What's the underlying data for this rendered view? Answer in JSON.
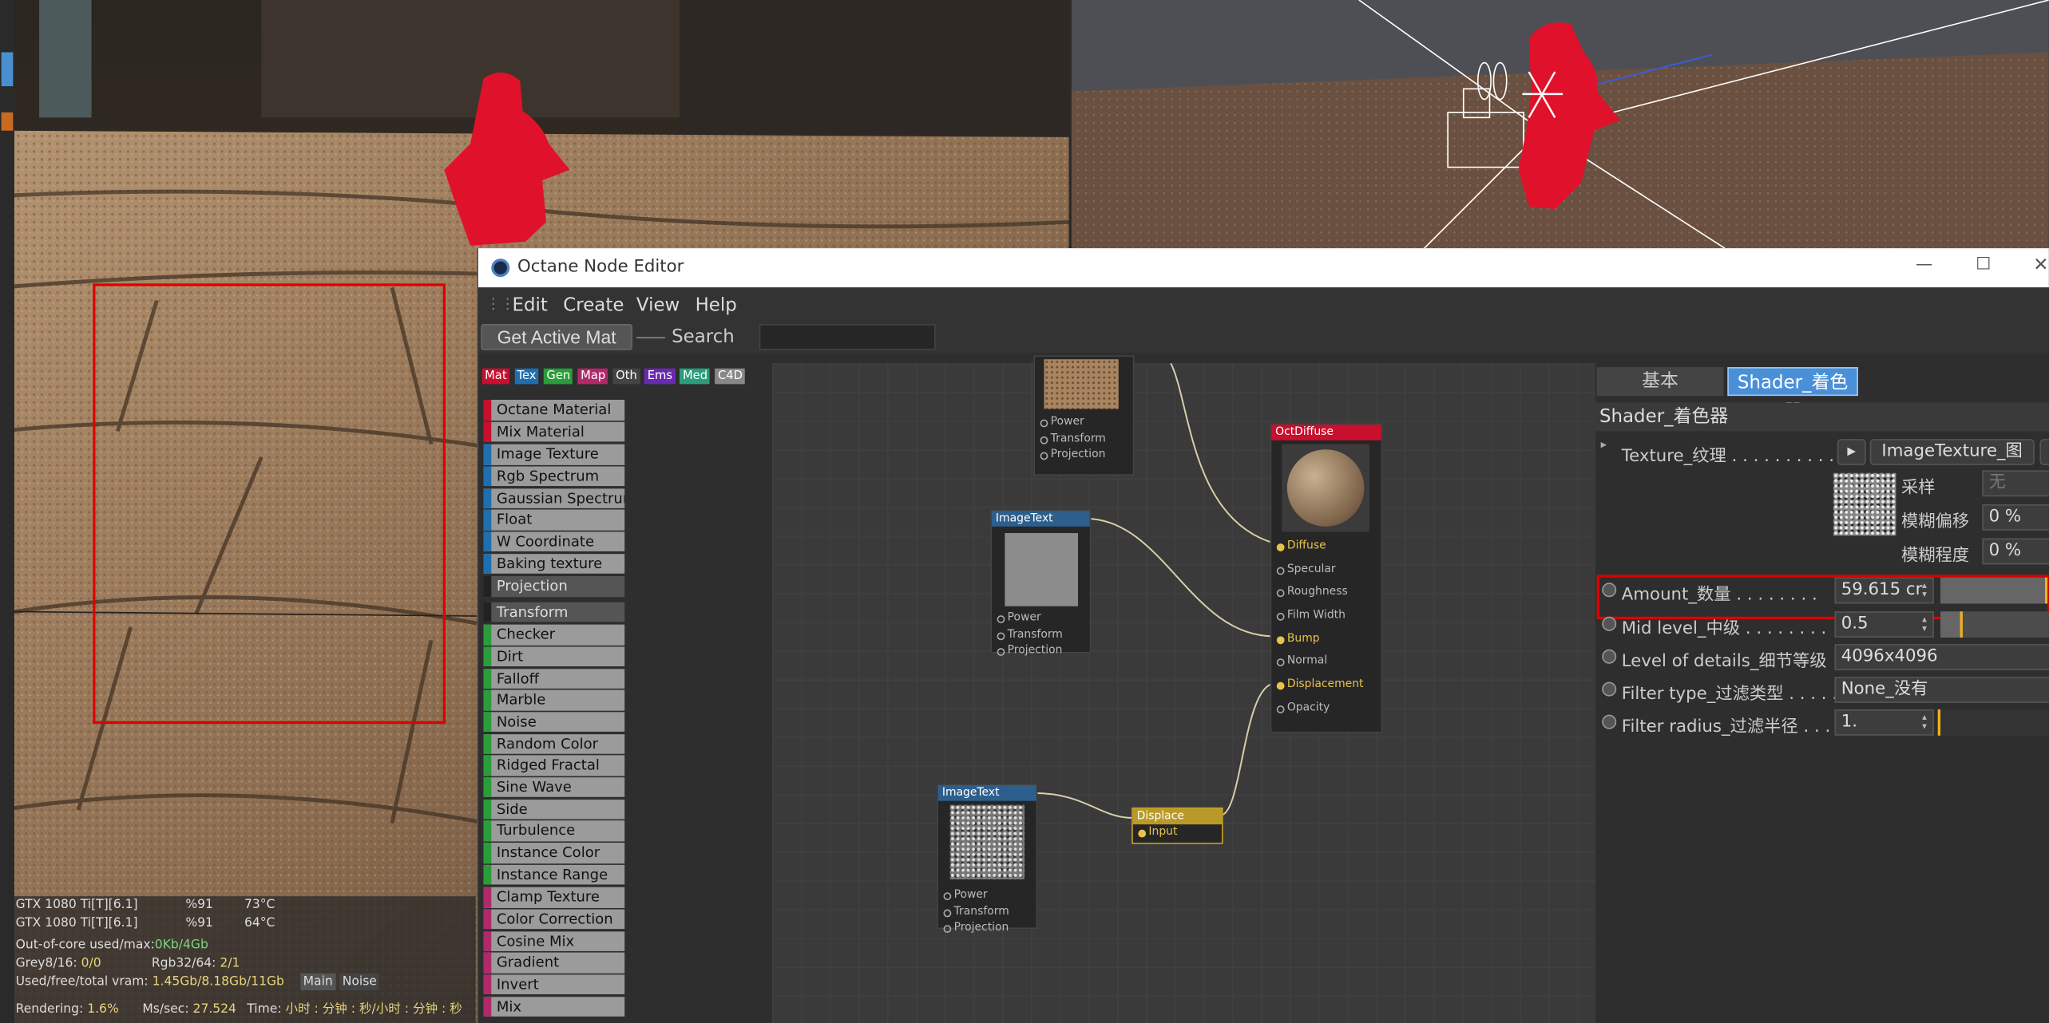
{
  "node_editor": {
    "title": "Octane Node Editor",
    "window_controls": {
      "minimize": "—",
      "maximize": "☐",
      "close": "✕"
    },
    "menu": [
      "Edit",
      "Create",
      "View",
      "Help"
    ],
    "get_active_mat": "Get Active Mat",
    "search_label": "Search",
    "search_value": "",
    "category_tabs": [
      {
        "label": "Mat",
        "color": "#c8102e"
      },
      {
        "label": "Tex",
        "color": "#1f6fb0"
      },
      {
        "label": "Gen",
        "color": "#2a9d3a"
      },
      {
        "label": "Map",
        "color": "#b02a6a"
      },
      {
        "label": "Oth",
        "color": "#444444"
      },
      {
        "label": "Ems",
        "color": "#6a2ab0"
      },
      {
        "label": "Med",
        "color": "#2a9d7a"
      },
      {
        "label": "C4D",
        "color": "#888888"
      }
    ],
    "palette": [
      {
        "label": "Octane Material",
        "color": "#c8102e"
      },
      {
        "label": "Mix Material",
        "color": "#c8102e"
      },
      {
        "label": "Image Texture",
        "color": "#1f6fb0"
      },
      {
        "label": "Rgb Spectrum",
        "color": "#1f6fb0"
      },
      {
        "label": "Gaussian Spectrum",
        "color": "#1f6fb0"
      },
      {
        "label": "Float",
        "color": "#1f6fb0"
      },
      {
        "label": "W Coordinate",
        "color": "#1f6fb0"
      },
      {
        "label": "Baking texture",
        "color": "#1f6fb0"
      },
      {
        "label": "Projection",
        "color": "#222222"
      },
      {
        "label": "Transform",
        "color": "#222222"
      },
      {
        "label": "Checker",
        "color": "#2a9d3a"
      },
      {
        "label": "Dirt",
        "color": "#2a9d3a"
      },
      {
        "label": "Falloff",
        "color": "#2a9d3a"
      },
      {
        "label": "Marble",
        "color": "#2a9d3a"
      },
      {
        "label": "Noise",
        "color": "#2a9d3a"
      },
      {
        "label": "Random Color",
        "color": "#2a9d3a"
      },
      {
        "label": "Ridged Fractal",
        "color": "#2a9d3a"
      },
      {
        "label": "Sine Wave",
        "color": "#2a9d3a"
      },
      {
        "label": "Side",
        "color": "#2a9d3a"
      },
      {
        "label": "Turbulence",
        "color": "#2a9d3a"
      },
      {
        "label": "Instance Color",
        "color": "#2a9d3a"
      },
      {
        "label": "Instance Range",
        "color": "#2a9d3a"
      },
      {
        "label": "Clamp Texture",
        "color": "#b02a6a"
      },
      {
        "label": "Color Correction",
        "color": "#b02a6a"
      },
      {
        "label": "Cosine Mix",
        "color": "#b02a6a"
      },
      {
        "label": "Gradient",
        "color": "#b02a6a"
      },
      {
        "label": "Invert",
        "color": "#b02a6a"
      },
      {
        "label": "Mix",
        "color": "#b02a6a"
      }
    ],
    "nodes": {
      "top_image": {
        "ports": [
          "Power",
          "Transform",
          "Projection"
        ]
      },
      "image_mid": {
        "title": "ImageText",
        "ports": [
          "Power",
          "Transform",
          "Projection"
        ]
      },
      "image_low": {
        "title": "ImageText",
        "ports": [
          "Power",
          "Transform",
          "Projection"
        ]
      },
      "diffuse": {
        "title": "OctDiffuse",
        "ports": [
          "Diffuse",
          "Specular",
          "Roughness",
          "Film Width",
          "Bump",
          "Normal",
          "Displacement",
          "Opacity"
        ]
      },
      "displace": {
        "title": "Displace",
        "port": "Input"
      }
    },
    "right_panel": {
      "tab_basic": "基本",
      "tab_shader": "Shader_着色器",
      "section_title": "Shader_着色器",
      "texture_label": "Texture_纹理 . . . . . . . . . . . .",
      "texture_value": "ImageTexture_图",
      "sampling_label": "采样",
      "sampling_value": "无",
      "blur_offset_label": "模糊偏移",
      "blur_offset_value": "0 %",
      "blur_degree_label": "模糊程度",
      "blur_degree_value": "0 %",
      "amount_label": "Amount_数量 . . . . . . . .",
      "amount_value": "59.615 cr",
      "amount_fill": 0.98,
      "mid_label": "Mid level_中级 . . . . . . . .",
      "mid_value": "0.5",
      "mid_fill": 0.2,
      "lod_label": "Level of details_细节等级",
      "lod_value": "4096x4096",
      "filter_type_label": "Filter type_过滤类型 . . . . .",
      "filter_type_value": "None_没有",
      "filter_radius_label": "Filter radius_过滤半径 . . .",
      "filter_radius_value": "1.",
      "filter_radius_fill": 0.02
    }
  },
  "render_stats": {
    "gpu1": {
      "name": "GTX 1080 Ti[T][6.1]",
      "load": "%91",
      "temp": "73°C"
    },
    "gpu2": {
      "name": "GTX 1080 Ti[T][6.1]",
      "load": "%91",
      "temp": "64°C"
    },
    "out_of_core_label": "Out-of-core used/max:",
    "out_of_core_value": "0Kb/4Gb",
    "grey_label": "Grey8/16:",
    "grey_value": "0/0",
    "rgb_label": "Rgb32/64:",
    "rgb_value": "2/1",
    "vram_label": "Used/free/total vram:",
    "vram_value": "1.45Gb/8.18Gb/11Gb",
    "tab_main": "Main",
    "tab_noise": "Noise",
    "rendering_label": "Rendering:",
    "rendering_value": "1.6%",
    "ms_label": "Ms/sec:",
    "ms_value": "27.524",
    "time_label": "Time:",
    "time_value": "小时 : 分钟 : 秒/小时 : 分钟 : 秒"
  }
}
